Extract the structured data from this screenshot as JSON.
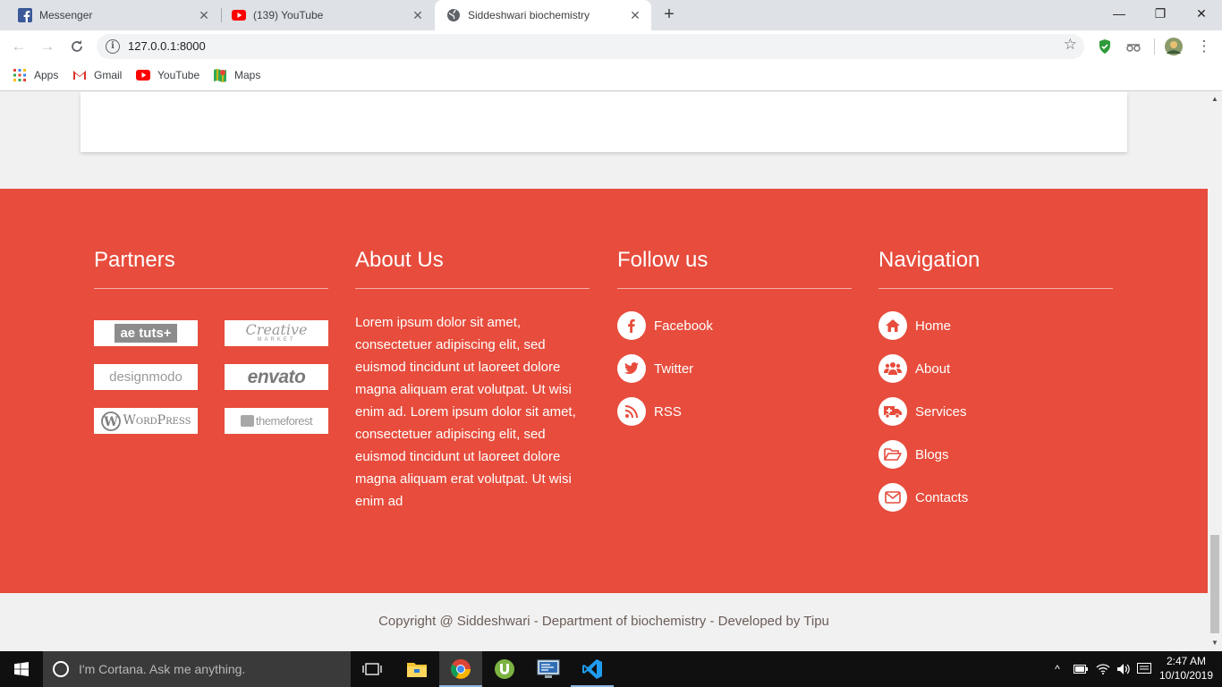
{
  "browser": {
    "tabs": [
      {
        "title": "Messenger",
        "icon": "facebook-icon"
      },
      {
        "title": "(139) YouTube",
        "icon": "youtube-icon"
      },
      {
        "title": "Siddeshwari biochemistry",
        "icon": "globe-icon",
        "active": true
      }
    ],
    "url": "127.0.0.1:8000",
    "bookmarks": [
      {
        "label": "Apps",
        "icon": "apps-grid-icon"
      },
      {
        "label": "Gmail",
        "icon": "gmail-icon"
      },
      {
        "label": "YouTube",
        "icon": "youtube-icon"
      },
      {
        "label": "Maps",
        "icon": "maps-icon"
      }
    ]
  },
  "footer": {
    "partners": {
      "title": "Partners",
      "logos": [
        "ae tuts+",
        "Creative",
        "MARKET",
        "designmodo",
        "envato",
        "WordPress",
        "themeforest"
      ]
    },
    "about": {
      "title": "About Us",
      "text": "Lorem ipsum dolor sit amet, consectetuer adipiscing elit, sed euismod tincidunt ut laoreet dolore magna aliquam erat volutpat. Ut wisi enim ad. Lorem ipsum dolor sit amet, consectetuer adipiscing elit, sed euismod tincidunt ut laoreet dolore magna aliquam erat volutpat. Ut wisi enim ad"
    },
    "follow": {
      "title": "Follow us",
      "links": [
        {
          "label": "Facebook",
          "icon": "facebook-icon"
        },
        {
          "label": "Twitter",
          "icon": "twitter-icon"
        },
        {
          "label": "RSS",
          "icon": "rss-icon"
        }
      ]
    },
    "navigation": {
      "title": "Navigation",
      "links": [
        {
          "label": "Home",
          "icon": "home-icon"
        },
        {
          "label": "About",
          "icon": "users-icon"
        },
        {
          "label": "Services",
          "icon": "ambulance-icon"
        },
        {
          "label": "Blogs",
          "icon": "folder-open-icon"
        },
        {
          "label": "Contacts",
          "icon": "envelope-icon"
        }
      ]
    },
    "copyright": "Copyright @ Siddeshwari - Department of biochemistry - Developed by Tipu"
  },
  "taskbar": {
    "search_placeholder": "I'm Cortana. Ask me anything.",
    "time": "2:47 AM",
    "date": "10/10/2019"
  },
  "colors": {
    "footer_bg": "#e74c3c",
    "page_bg": "#f1f1f1",
    "copyright_text": "#6b5d57"
  }
}
